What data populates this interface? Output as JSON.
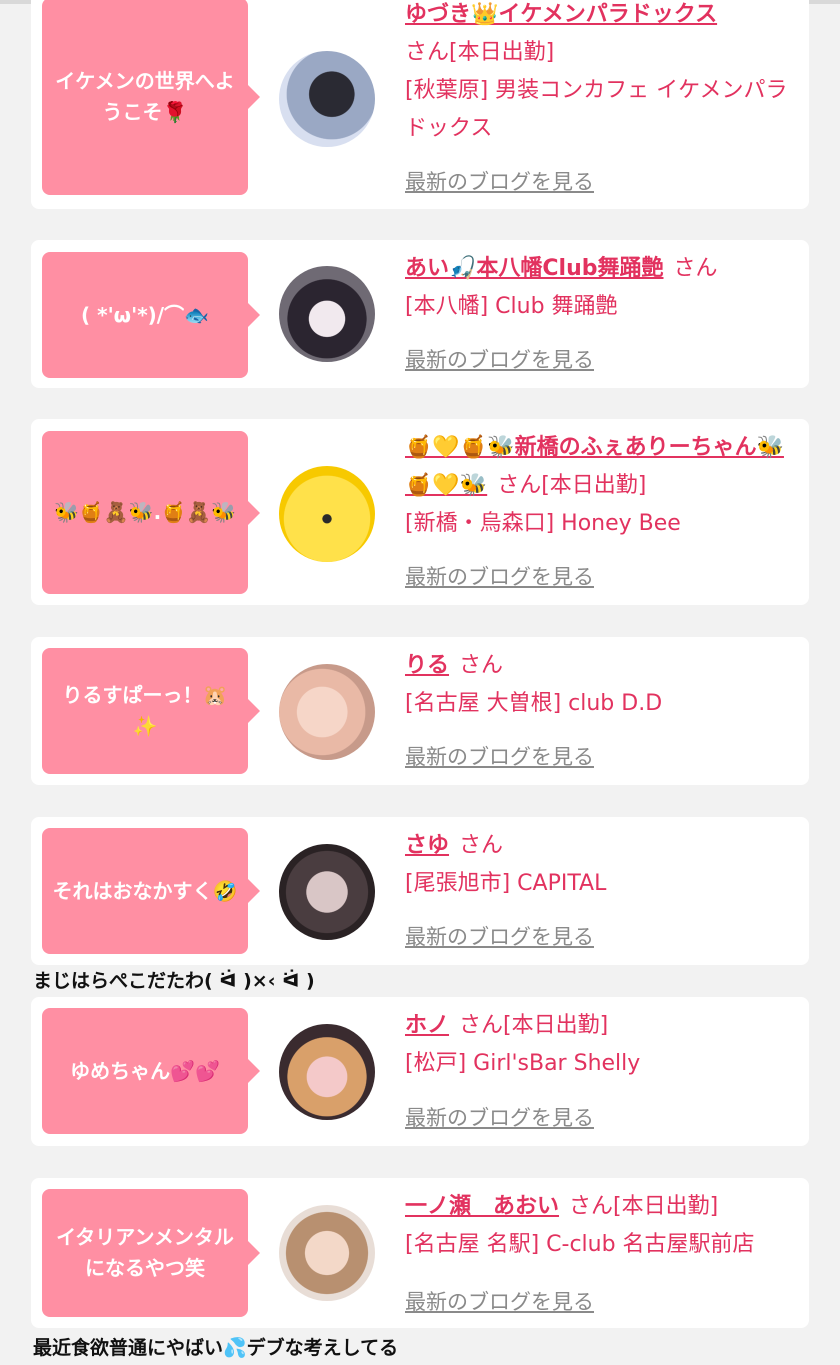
{
  "colors": {
    "accent": "#e2325f",
    "bubble": "#ff8fa3",
    "muted": "#8a8a8a"
  },
  "entries": [
    {
      "bubble": "イケメンの世界へようこそ🌹",
      "name": "ゆづき👑イケメンパラドックス",
      "san": "さん",
      "status": "[本日出勤]",
      "shop": "[秋葉原] 男装コンカフェ イケメンパラドックス",
      "blog": "最新のブログを見る"
    },
    {
      "bubble": "( *'ω'*)/⌒🐟",
      "name": "あい🎣本八幡Club舞踊艶",
      "san": "さん",
      "status": "",
      "shop": "[本八幡] Club 舞踊艶",
      "blog": "最新のブログを見る"
    },
    {
      "bubble": "🐝🍯🧸🐝.🍯🧸🐝",
      "name": "🍯💛🍯🐝新橋のふぇありーちゃん🐝🍯💛🐝",
      "san": "さん",
      "status": "[本日出勤]",
      "shop": "[新橋・烏森口] Honey Bee",
      "blog": "最新のブログを見る"
    },
    {
      "bubble": "りるすぱーっ！🐹✨",
      "name": "りる",
      "san": "さん",
      "status": "",
      "shop": "[名古屋 大曽根] club D.D",
      "blog": "最新のブログを見る"
    },
    {
      "bubble": "それはおなかすく🤣",
      "name": "さゆ",
      "san": "さん",
      "status": "",
      "shop": "[尾張旭市] CAPITAL",
      "blog": "最新のブログを見る",
      "caption": "まじはらぺこだたわ( ᐛ )×‹ ᐛ )"
    },
    {
      "bubble": "ゆめちゃん💕💕",
      "name": "ホノ",
      "san": "さん",
      "status": "[本日出勤]",
      "shop": "[松戸] Girl'sBar Shelly",
      "blog": "最新のブログを見る"
    },
    {
      "bubble": "イタリアンメンタルになるやつ笑",
      "name": "一ノ瀬　あおい",
      "san": "さん",
      "status": "[本日出勤]",
      "shop": "[名古屋 名駅] C-club 名古屋駅前店",
      "blog": "最新のブログを見る",
      "caption": "最近食欲普通にやばい💦デブな考えしてる"
    }
  ]
}
